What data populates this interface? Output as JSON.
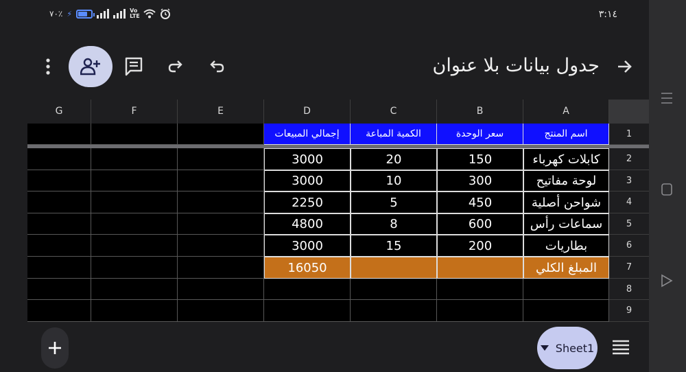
{
  "status_bar": {
    "time": "٣:١٤",
    "battery_percent": "٧٠٪",
    "battery_level": 0.7,
    "volte": "Vo LTE"
  },
  "toolbar": {
    "title": "جدول بيانات بلا عنوان",
    "back_icon": "arrow-right-icon",
    "undo_icon": "undo-icon",
    "redo_icon": "redo-icon",
    "comment_icon": "comment-icon",
    "share_icon": "add-person-icon",
    "more_icon": "more-vert-icon"
  },
  "columns": [
    "G",
    "F",
    "E",
    "D",
    "C",
    "B",
    "A"
  ],
  "rows": [
    {
      "num": "1",
      "cells": [
        "",
        "",
        "",
        "إجمالي المبيعات",
        "الكمية المباعة",
        "سعر الوحدة",
        "اسم المنتج"
      ]
    },
    {
      "num": "2",
      "cells": [
        "",
        "",
        "",
        "3000",
        "20",
        "150",
        "كابلات كهرباء"
      ]
    },
    {
      "num": "3",
      "cells": [
        "",
        "",
        "",
        "3000",
        "10",
        "300",
        "لوحة مفاتيح"
      ]
    },
    {
      "num": "4",
      "cells": [
        "",
        "",
        "",
        "2250",
        "5",
        "450",
        "شواحن أصلية"
      ]
    },
    {
      "num": "5",
      "cells": [
        "",
        "",
        "",
        "4800",
        "8",
        "600",
        "سماعات رأس"
      ]
    },
    {
      "num": "6",
      "cells": [
        "",
        "",
        "",
        "3000",
        "15",
        "200",
        "بطاريات"
      ]
    },
    {
      "num": "7",
      "cells": [
        "",
        "",
        "",
        "16050",
        "",
        "",
        "المبلغ الكلي"
      ]
    },
    {
      "num": "8",
      "cells": [
        "",
        "",
        "",
        "",
        "",
        "",
        ""
      ]
    },
    {
      "num": "9",
      "cells": [
        "",
        "",
        "",
        "",
        "",
        "",
        ""
      ]
    }
  ],
  "colors": {
    "header_fill": "#1010ff",
    "total_fill": "#c4701a",
    "accent": "#cdd2ec"
  },
  "bottom_bar": {
    "sheet_tab": "Sheet1",
    "add_icon": "plus-icon",
    "sheets_list_icon": "menu-icon"
  },
  "nav": {
    "recents_icon": "recents-icon",
    "home_icon": "home-icon",
    "back_icon": "back-triangle-icon"
  }
}
